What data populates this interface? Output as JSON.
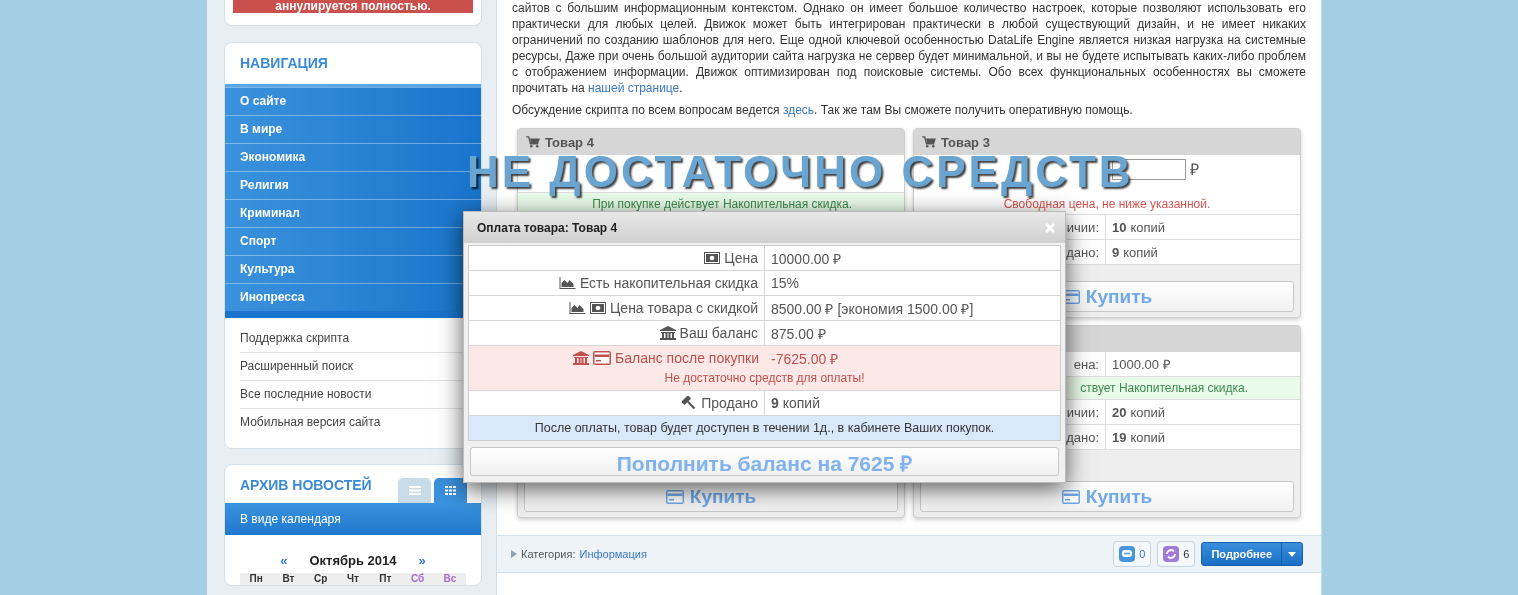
{
  "sidebar": {
    "notice": "аннулируется полностью.",
    "navigation": {
      "title": "НАВИГАЦИЯ",
      "items": [
        "О сайте",
        "В мире",
        "Экономика",
        "Религия",
        "Криминал",
        "Спорт",
        "Культура",
        "Инопресса"
      ],
      "links": [
        "Поддержка скрипта",
        "Расширенный поиск",
        "Все последние новости",
        "Мобильная версия сайта"
      ]
    },
    "archive": {
      "title": "АРХИВ НОВОСТЕЙ",
      "view_tabs": [
        {
          "kind": "list",
          "selected": false
        },
        {
          "kind": "grid",
          "selected": true
        }
      ],
      "bar": "В виде календаря",
      "calendar": {
        "prev": "«",
        "month": "Октябрь 2014",
        "next": "»",
        "weekdays": [
          {
            "label": "Пн",
            "weekend": false
          },
          {
            "label": "Вт",
            "weekend": false
          },
          {
            "label": "Ср",
            "weekend": false
          },
          {
            "label": "Чт",
            "weekend": false
          },
          {
            "label": "Пт",
            "weekend": false
          },
          {
            "label": "Сб",
            "weekend": true
          },
          {
            "label": "Вс",
            "weekend": true
          }
        ]
      }
    }
  },
  "article": {
    "paragraphs": [
      {
        "before": "сайтов с большим информационным контекстом. Однако он имеет большое количество настроек, которые позволяют использовать его практически для любых целей. Движок может быть интегрирован практически в любой существующий дизайн, и не имеет никаких ограничений по созданию шаблонов для него. Еще одной ключевой особенностью DataLife Engine является низкая нагрузка на системные ресурсы, Даже при очень большой аудитории сайта нагрузка не сервер будет минимальной, и вы не будете испытывать каких-либо проблем с отображением информации. Движок оптимизирован под поисковые системы. Обо всех функциональных особенностях вы сможете прочитать на ",
        "link": "нашей странице",
        "after": "."
      },
      {
        "before": "Обсуждение скрипта по всем вопросам ведется ",
        "link": "здесь",
        "after": ". Так же там Вы сможете получить оперативную помощь."
      }
    ]
  },
  "products": [
    {
      "title": "Товар 4",
      "rows": [
        {
          "kind": "covered"
        },
        {
          "kind": "note",
          "text": "При покупке действует Накопительная скидка."
        }
      ]
    },
    {
      "title": "Товар 3",
      "rows": [
        {
          "kind": "free_price",
          "currency": "₽",
          "note": "Свободная цена, не ниже указанной."
        },
        {
          "kind": "stock",
          "label": "ичии:",
          "value": "**10** копий"
        },
        {
          "kind": "stock",
          "label": "дано:",
          "value": "**9** копий"
        }
      ],
      "buy": "Купить"
    },
    {
      "buy": "Купить"
    },
    {
      "rows": [
        {
          "kind": "price_partial",
          "label": "ена:",
          "value": "1000.00 ₽"
        },
        {
          "kind": "note",
          "text": "ствует Накопительная скидка."
        },
        {
          "kind": "stock",
          "label": "ичии:",
          "value": "**20** копий"
        },
        {
          "kind": "stock",
          "label": "дано:",
          "value": "**19** копий"
        }
      ],
      "buy": "Купить"
    }
  ],
  "post_footer": {
    "category_label": "Категория:",
    "category_link": "Информация",
    "comments": "0",
    "reposts": "6",
    "more_button": "Подробнее"
  },
  "overlay_caption": "НЕ ДОСТАТОЧНО СРЕДСТВ",
  "payment_dialog": {
    "title": "Оплата товара: Товар 4",
    "rows": [
      {
        "kind": "price",
        "label": "Цена",
        "value": "10000.00 ₽"
      },
      {
        "kind": "discount",
        "label": "Есть накопительная скидка",
        "value": "15%"
      },
      {
        "kind": "discounted_price",
        "label": "Цена товара с скидкой",
        "value": "8500.00 ₽ [экономия 1500.00 ₽]"
      },
      {
        "kind": "balance",
        "label": "Ваш баланс",
        "value": "875.00 ₽"
      },
      {
        "kind": "balance_after",
        "label": "Баланс после покупки",
        "value": "-7625.00 ₽",
        "error": "Не достаточно средств для оплаты!"
      },
      {
        "kind": "sold",
        "label": "Продано",
        "value": "**9** копий"
      }
    ],
    "info": "После оплаты, товар будет доступен в течении 1д., в кабинете Ваших покупок.",
    "button": "Пополнить баланс на 7625 ₽"
  }
}
